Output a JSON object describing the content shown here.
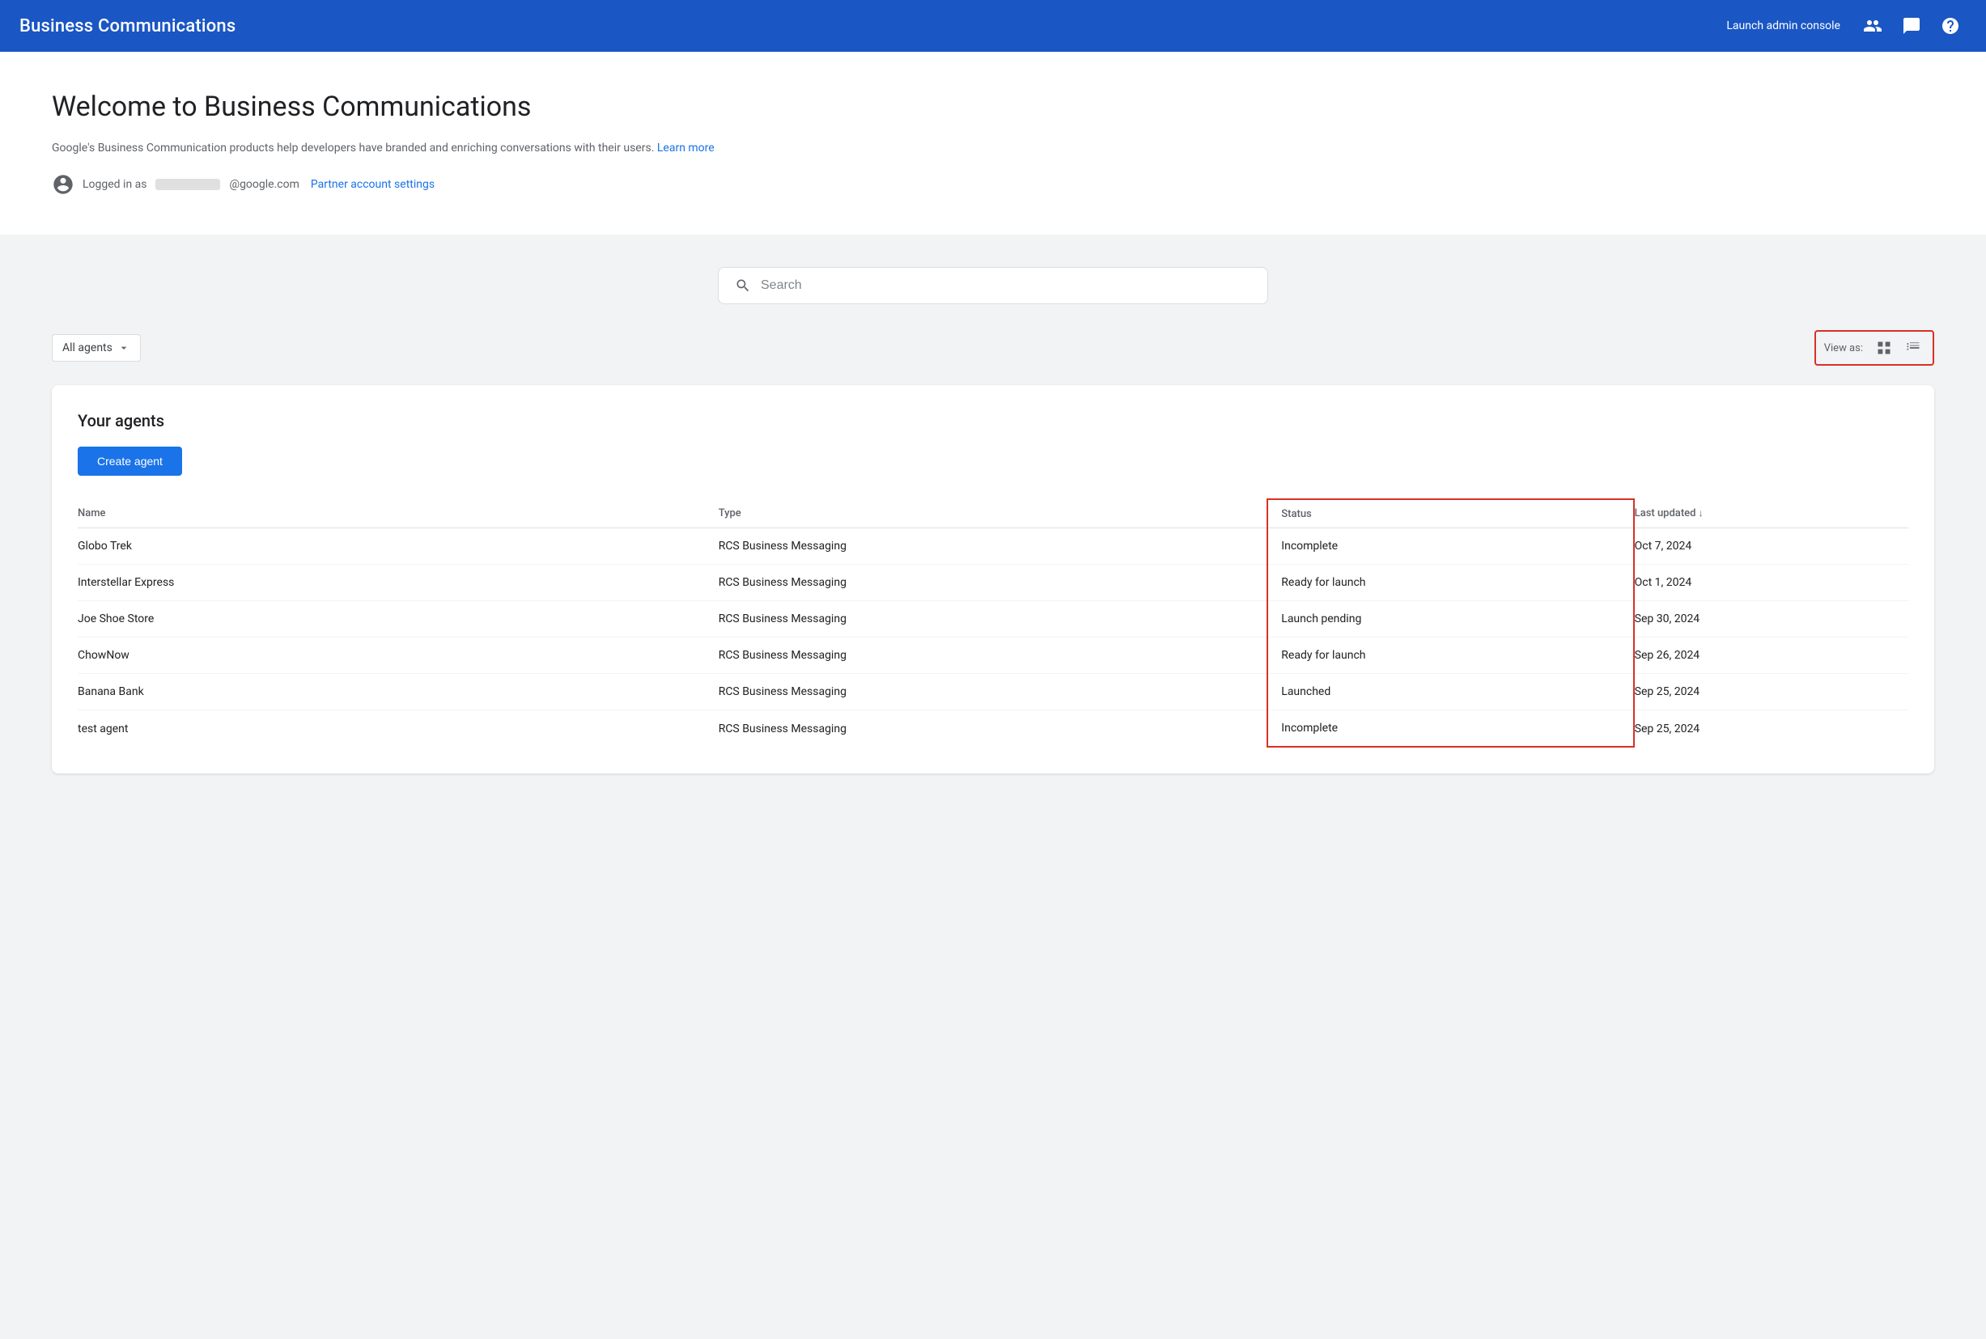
{
  "header": {
    "title": "Business Communications",
    "launch_admin_label": "Launch admin console",
    "icons": [
      "people-icon",
      "chat-icon",
      "help-icon"
    ]
  },
  "welcome": {
    "title": "Welcome to Business Communications",
    "description": "Google's Business Communication products help developers have branded and enriching conversations with their users.",
    "learn_more_label": "Learn more",
    "logged_in_label": "Logged in as",
    "email_domain": "@google.com",
    "partner_settings_label": "Partner account settings"
  },
  "search": {
    "placeholder": "Search"
  },
  "filter": {
    "label": "All agents"
  },
  "view_as": {
    "label": "View as:"
  },
  "agents": {
    "section_title": "Your agents",
    "create_button": "Create agent",
    "table": {
      "columns": [
        "Name",
        "Type",
        "Status",
        "Last updated"
      ],
      "sort_column": "Last updated",
      "rows": [
        {
          "name": "Globo Trek",
          "type": "RCS Business Messaging",
          "status": "Incomplete",
          "updated": "Oct 7, 2024"
        },
        {
          "name": "Interstellar Express",
          "type": "RCS Business Messaging",
          "status": "Ready for launch",
          "updated": "Oct 1, 2024"
        },
        {
          "name": "Joe Shoe Store",
          "type": "RCS Business Messaging",
          "status": "Launch pending",
          "updated": "Sep 30, 2024"
        },
        {
          "name": "ChowNow",
          "type": "RCS Business Messaging",
          "status": "Ready for launch",
          "updated": "Sep 26, 2024"
        },
        {
          "name": "Banana Bank",
          "type": "RCS Business Messaging",
          "status": "Launched",
          "updated": "Sep 25, 2024"
        },
        {
          "name": "test agent",
          "type": "RCS Business Messaging",
          "status": "Incomplete",
          "updated": "Sep 25, 2024"
        }
      ]
    }
  }
}
